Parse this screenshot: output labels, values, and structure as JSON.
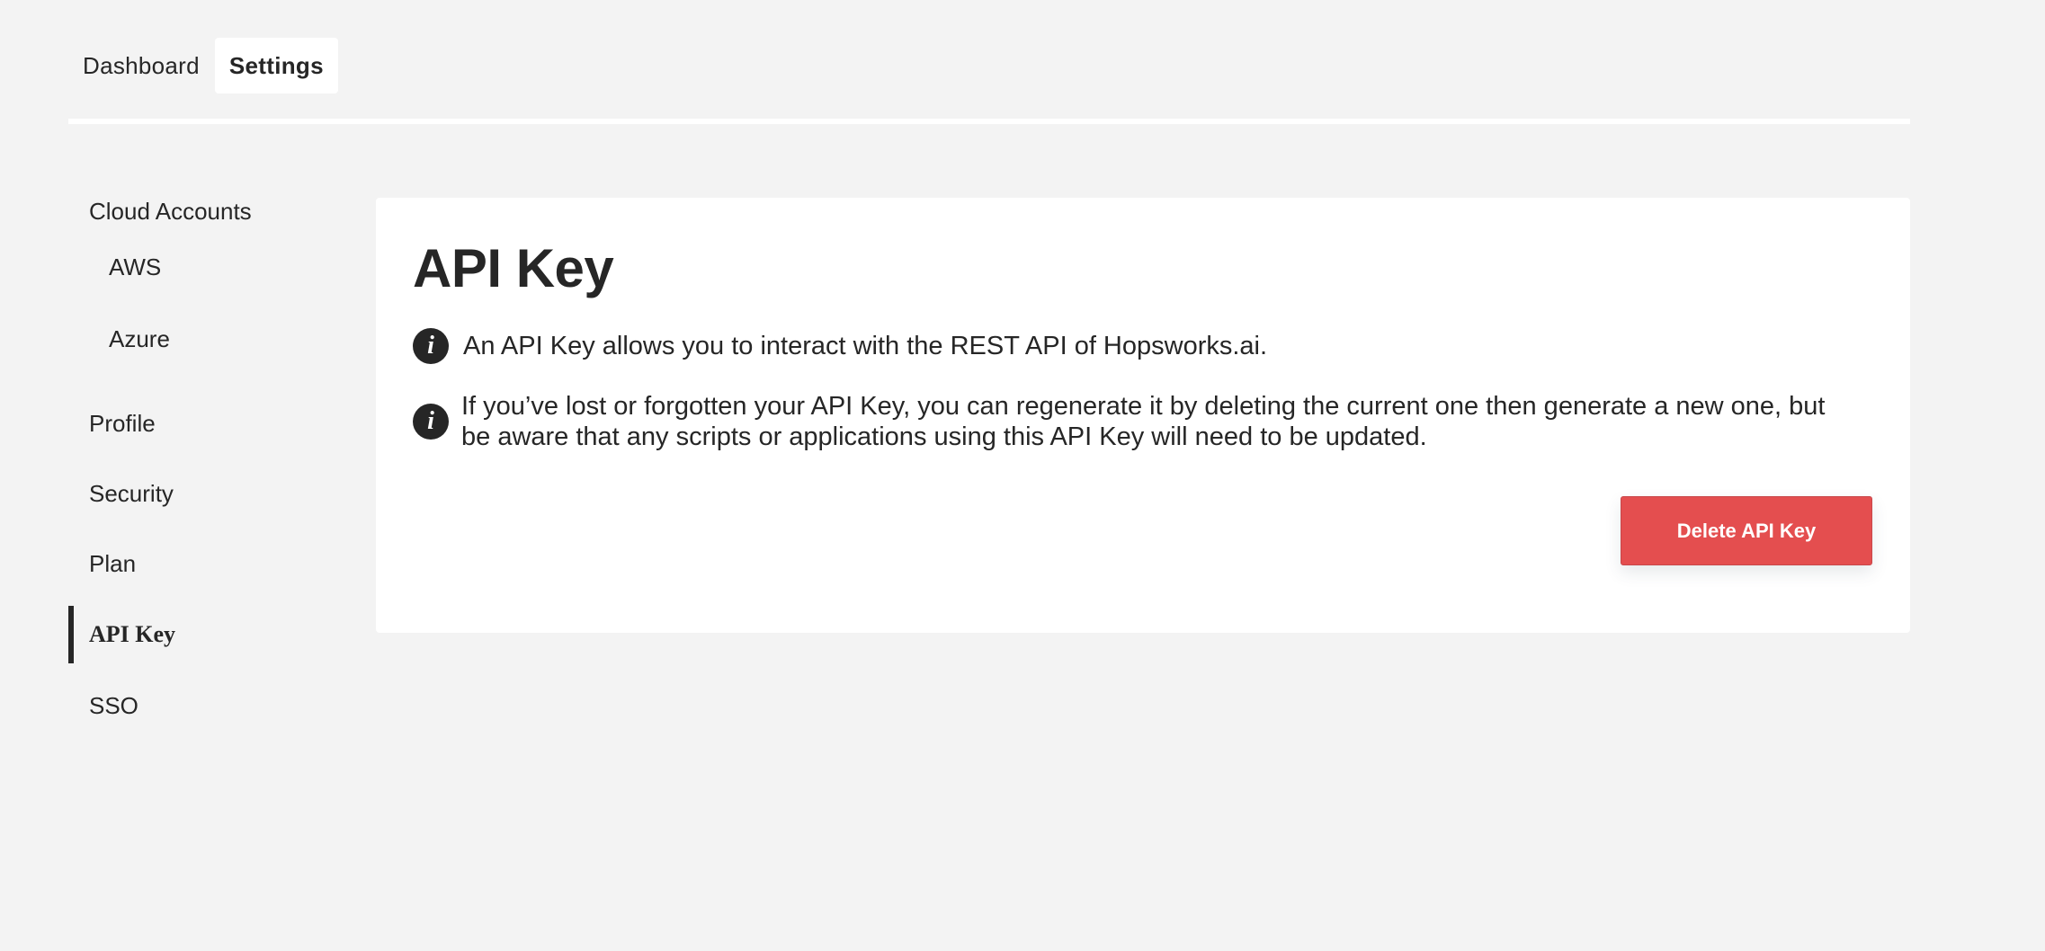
{
  "topnav": {
    "tabs": [
      {
        "label": "Dashboard",
        "active": false
      },
      {
        "label": "Settings",
        "active": true
      }
    ]
  },
  "sidebar": {
    "items": [
      {
        "label": "Cloud Accounts",
        "type": "heading"
      },
      {
        "label": "AWS",
        "type": "sub"
      },
      {
        "label": "Azure",
        "type": "sub"
      },
      {
        "label": "Profile",
        "type": "item"
      },
      {
        "label": "Security",
        "type": "item"
      },
      {
        "label": "Plan",
        "type": "item"
      },
      {
        "label": "API Key",
        "type": "item",
        "active": true
      },
      {
        "label": "SSO",
        "type": "item"
      }
    ]
  },
  "main": {
    "title": "API Key",
    "info": [
      {
        "icon": "info-icon",
        "glyph": "i",
        "text": "An API Key allows you to interact with the REST API of Hopsworks.ai."
      },
      {
        "icon": "info-icon",
        "glyph": "i",
        "text": "If you’ve lost or forgotten your API Key, you can regenerate it by deleting the current one then generate a new one, but be aware that any scripts or applications using this API Key will need to be updated."
      }
    ],
    "delete_button_label": "Delete API Key"
  },
  "colors": {
    "background": "#f3f3f3",
    "text": "#262626",
    "danger": "#e44e4f"
  }
}
